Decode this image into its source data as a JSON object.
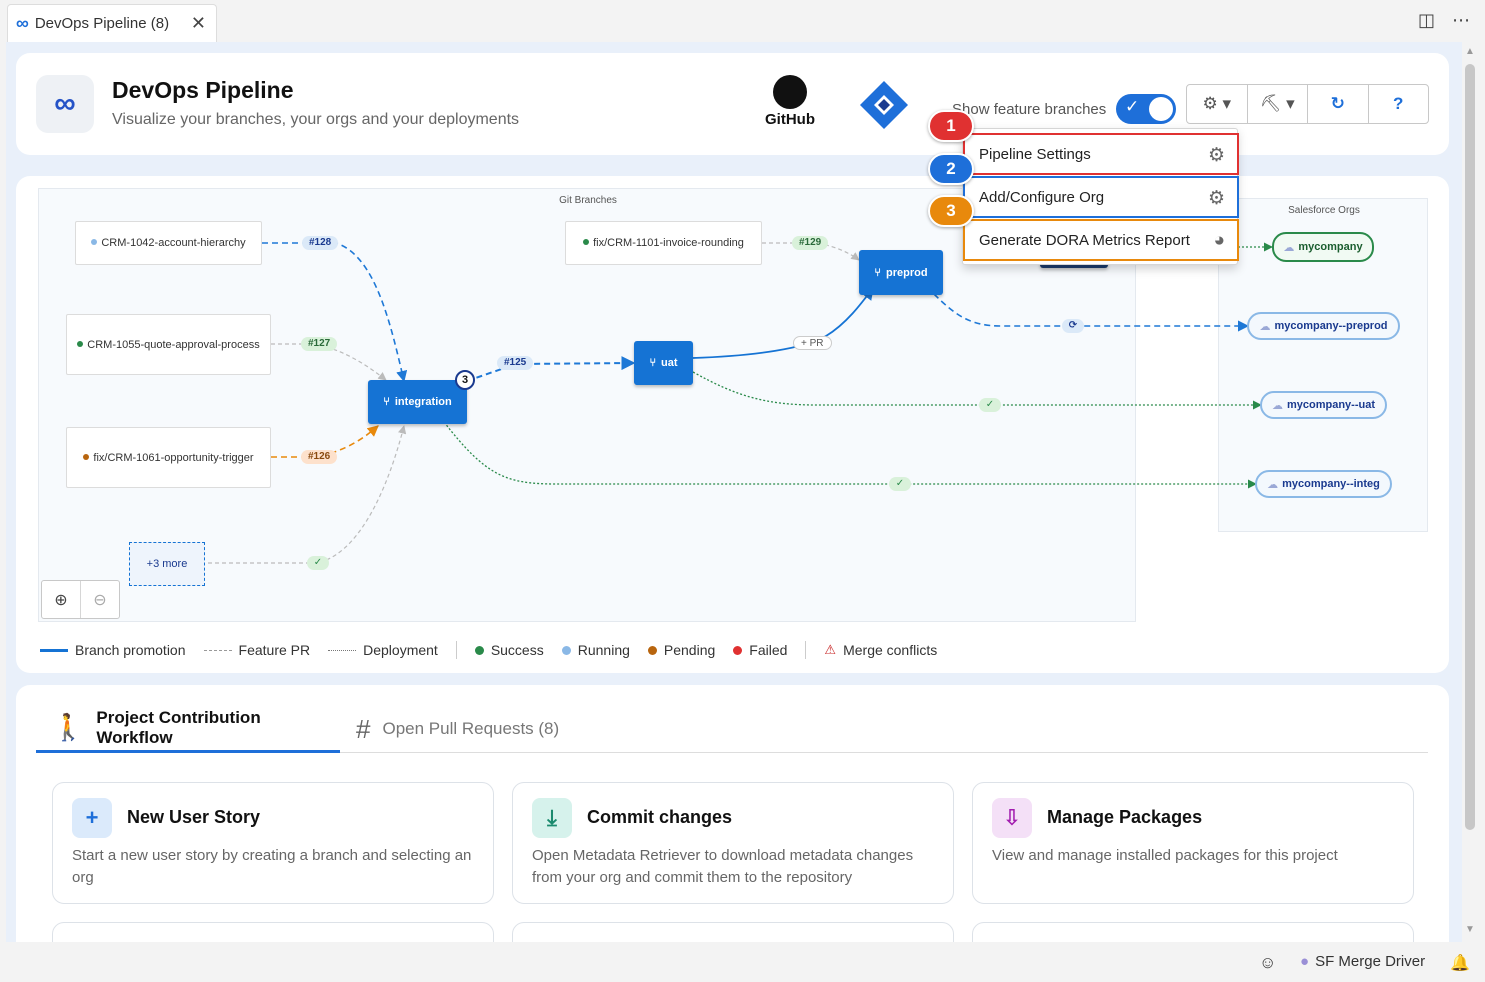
{
  "tab": {
    "title": "DevOps Pipeline (8)",
    "icon": "infinity-icon"
  },
  "header": {
    "title": "DevOps Pipeline",
    "subtitle": "Visualize your branches, your orgs and your deployments",
    "github_label": "GitHub",
    "toggle_label": "Show feature branches",
    "toggle_on": true
  },
  "diagram": {
    "git_title": "Git Branches",
    "orgs_title": "Salesforce Orgs",
    "feature_branches": [
      {
        "label": "CRM-1042-account-hierarchy",
        "status": "running"
      },
      {
        "label": "CRM-1055-quote-approval-process",
        "status": "success"
      },
      {
        "label": "fix/CRM-1061-opportunity-trigger",
        "status": "pending"
      },
      {
        "label": "fix/CRM-1101-invoice-rounding",
        "status": "success"
      }
    ],
    "prs": [
      "#128",
      "#127",
      "#126",
      "#129",
      "#125"
    ],
    "pr_pending_label": "+ PR",
    "more_label": "+3 more",
    "envs": [
      "integration",
      "uat",
      "preprod"
    ],
    "integration_count": "3",
    "orgs": [
      "mycompany",
      "mycompany--preprod",
      "mycompany--uat",
      "mycompany--integ"
    ]
  },
  "legend": {
    "branch_promotion": "Branch promotion",
    "feature_pr": "Feature PR",
    "deployment": "Deployment",
    "success": "Success",
    "running": "Running",
    "pending": "Pending",
    "failed": "Failed",
    "merge_conflicts": "Merge conflicts"
  },
  "menu": {
    "items": [
      {
        "num": "1",
        "label": "Pipeline Settings",
        "icon": "gear-icon",
        "color": "#e03131"
      },
      {
        "num": "2",
        "label": "Add/Configure Org",
        "icon": "gear-icon",
        "color": "#1e6fd9"
      },
      {
        "num": "3",
        "label": "Generate DORA Metrics Report",
        "icon": "pie-chart-icon",
        "color": "#e8890c"
      }
    ]
  },
  "workflow": {
    "tab_active": "Project Contribution Workflow",
    "tab_inactive": "Open Pull Requests (8)",
    "cards": [
      {
        "title": "New User Story",
        "desc": "Start a new user story by creating a branch and selecting an org",
        "icon": "plus-icon"
      },
      {
        "title": "Commit changes",
        "desc": "Open Metadata Retriever to download metadata changes from your org and commit them to the repository",
        "icon": "download-icon"
      },
      {
        "title": "Manage Packages",
        "desc": "View and manage installed packages for this project",
        "icon": "package-icon"
      }
    ]
  },
  "statusbar": {
    "extension": "SF Merge Driver"
  },
  "colors": {
    "accent": "#1e6fd9",
    "success": "#2a8a4a",
    "running": "#8ab8e6",
    "pending": "#b8650e",
    "failed": "#e03131"
  }
}
